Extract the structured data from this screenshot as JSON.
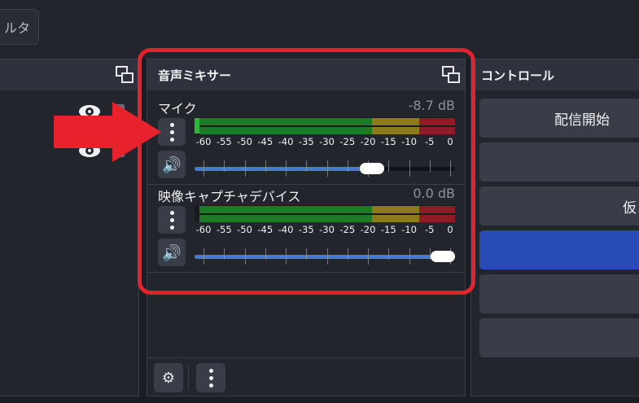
{
  "top": {
    "filter_button_label": "ルタ"
  },
  "mixer": {
    "title": "音声ミキサー",
    "channels": [
      {
        "name": "マイク",
        "db": "-8.7 dB",
        "volume": 0.68,
        "level": 0.02
      },
      {
        "name": "映像キャプチャデバイス",
        "db": "0.0 dB",
        "volume": 1.0,
        "level": 0.0
      }
    ],
    "scale": [
      "-60",
      "-55",
      "-50",
      "-45",
      "-40",
      "-35",
      "-30",
      "-25",
      "-20",
      "-15",
      "-10",
      "-5",
      "0"
    ]
  },
  "controls": {
    "title": "コントロール",
    "buttons": [
      {
        "label": "配信開始",
        "active": false
      },
      {
        "label": "",
        "active": false
      },
      {
        "label": "仮",
        "active": false
      },
      {
        "label": "",
        "active": true
      },
      {
        "label": "",
        "active": false
      },
      {
        "label": "",
        "active": false
      }
    ]
  },
  "colors": {
    "accent": "#284bb5",
    "highlight": "#e2222c",
    "meter_green": "#1f7a28",
    "meter_yellow": "#8c7a1c",
    "meter_red": "#8e1b25"
  }
}
